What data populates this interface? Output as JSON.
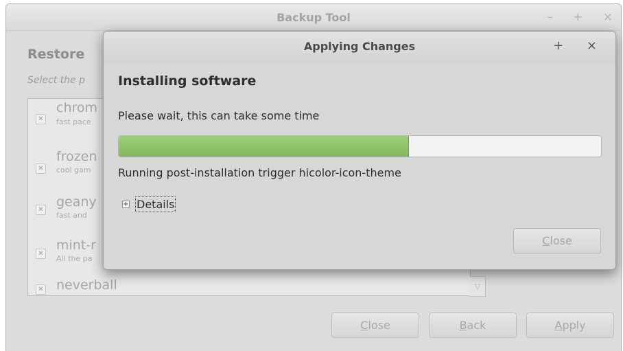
{
  "background_window": {
    "title": "Backup Tool",
    "wm_buttons": "– + ×",
    "heading": "Restore",
    "subtitle": "Select the p",
    "packages": [
      {
        "name": "chrom",
        "description": "fast pace"
      },
      {
        "name": "frozen",
        "description": "cool gam"
      },
      {
        "name": "geany",
        "description": "fast and"
      },
      {
        "name": "mint-r",
        "description": "All the pa"
      },
      {
        "name": "neverball",
        "description": ""
      }
    ],
    "buttons": {
      "close": {
        "mnemonic": "C",
        "rest": "lose"
      },
      "back": {
        "mnemonic": "B",
        "rest": "ack"
      },
      "apply": {
        "mnemonic": "A",
        "rest": "pply"
      }
    }
  },
  "dialog": {
    "title": "Applying Changes",
    "wm_buttons": "+ ×",
    "heading": "Installing software",
    "message": "Please wait, this can take some time",
    "progress_fraction": 0.6,
    "status": "Running post-installation trigger hicolor-icon-theme",
    "expander_symbol": "+",
    "details_label": "Details",
    "close_button": {
      "mnemonic": "C",
      "rest": "lose"
    }
  },
  "colors": {
    "progress_fill": "#9fcf7c",
    "dialog_bg": "#d7d7d7",
    "window_bg": "#dcdcdc"
  }
}
